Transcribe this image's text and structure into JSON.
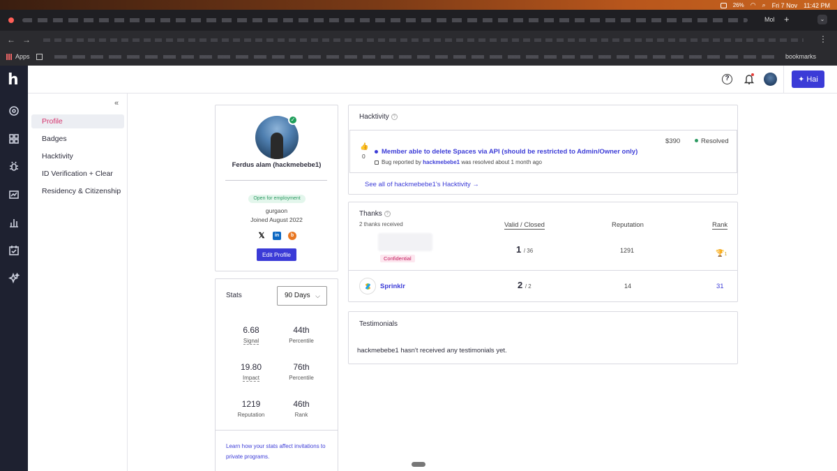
{
  "menubar": {
    "battery": "26%",
    "date": "Fri 7 Nov",
    "time": "11:42 PM"
  },
  "browser": {
    "tab_text": "Mol",
    "bookmarks_apps": "Apps",
    "bookmarks_all": "bookmarks"
  },
  "topbar": {
    "hai_label": "Hai"
  },
  "sidebar": {
    "collapse": "«",
    "items": [
      {
        "label": "Profile"
      },
      {
        "label": "Badges"
      },
      {
        "label": "Hacktivity"
      },
      {
        "label": "ID Verification + Clear"
      },
      {
        "label": "Residency & Citizenship"
      }
    ]
  },
  "profile": {
    "name": "Ferdus alam (hackmebebe1)",
    "badge": "Open for employment",
    "location": "gurgaon",
    "joined": "Joined August 2022",
    "edit_label": "Edit Profile"
  },
  "stats": {
    "title": "Stats",
    "period": "90 Days",
    "signal": "6.68",
    "signal_label": "Signal",
    "signal_pct": "44th",
    "signal_pct_label": "Percentile",
    "impact": "19.80",
    "impact_label": "Impact",
    "impact_pct": "76th",
    "impact_pct_label": "Percentile",
    "reputation": "1219",
    "reputation_label": "Reputation",
    "rank": "46th",
    "rank_label": "Rank",
    "link": "Learn how your stats affect invitations to private programs."
  },
  "hacktivity": {
    "title": "Hacktivity",
    "item": {
      "votes": "0",
      "title": "Member able to delete Spaces via API (should be restricted to Admin/Owner only)",
      "meta_prefix": "Bug reported by",
      "reporter": "hackmebebe1",
      "meta_suffix": "was resolved about 1 month ago",
      "bounty": "$390",
      "status": "Resolved"
    },
    "see_all": "See all of hackmebebe1's Hacktivity →"
  },
  "thanks": {
    "title": "Thanks",
    "subtitle": "2 thanks received",
    "columns": {
      "valid": "Valid / Closed",
      "reputation": "Reputation",
      "rank": "Rank"
    },
    "rows": [
      {
        "name": "Confidential",
        "valid": "1",
        "closed": "/ 36",
        "reputation": "1291",
        "rank": "1"
      },
      {
        "name": "Sprinklr",
        "valid": "2",
        "closed": "/ 2",
        "reputation": "14",
        "rank": "31"
      }
    ]
  },
  "testimonials": {
    "title": "Testimonials",
    "message": "hackmebebe1 hasn't received any testimonials yet."
  }
}
